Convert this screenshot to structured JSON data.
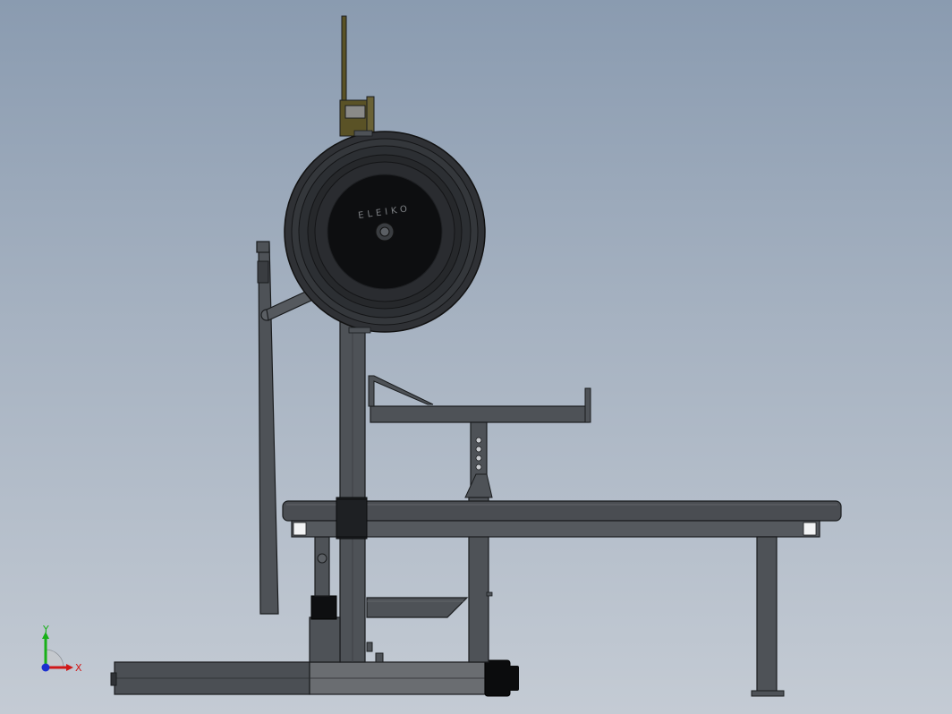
{
  "viewport": {
    "background_top": "#8a9bb0",
    "background_bottom": "#c4cbd4",
    "model_colors": {
      "frame": "#4e5257",
      "frame_dark": "#2f3236",
      "edge": "#1a1c1e",
      "plate": "#2b2d30",
      "plate_hub": "#0d0e10",
      "hook": "#5a5226",
      "end_cap": "#0b0c0d",
      "base_light": "#6a6d71"
    }
  },
  "plate": {
    "brand_text": "ELEIKO"
  },
  "triad": {
    "x_label": "X",
    "y_label": "Y",
    "x_color": "#d01818",
    "y_color": "#18b018",
    "z_color": "#1a2fd0"
  }
}
